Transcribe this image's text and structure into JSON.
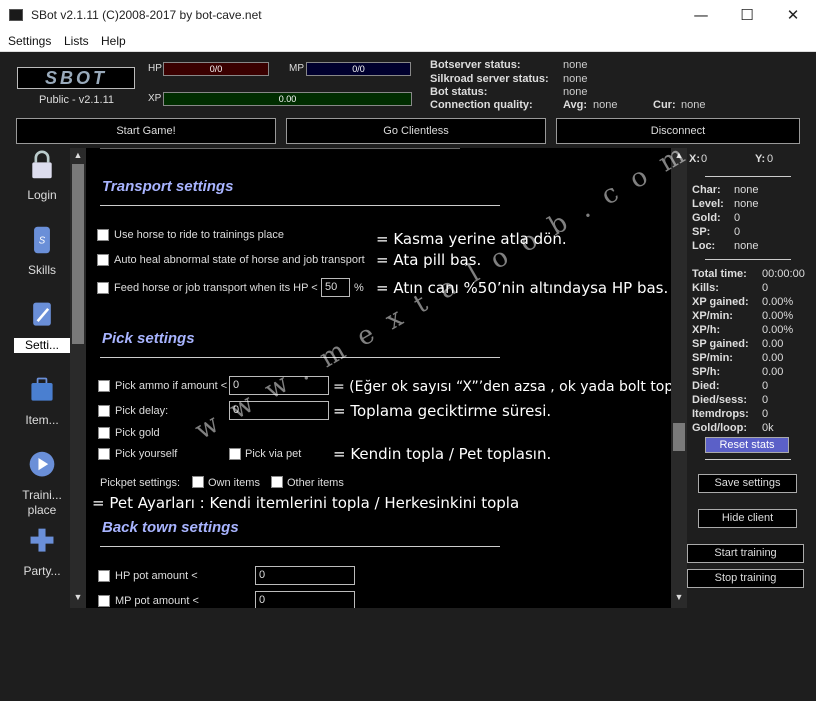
{
  "window": {
    "title": "SBot v2.1.11 (C)2008-2017 by bot-cave.net",
    "minimize": "—",
    "maximize": "☐",
    "close": "✕"
  },
  "menu": [
    "Settings",
    "Lists",
    "Help"
  ],
  "header": {
    "logo": "SBOT",
    "version": "Public - v2.1.11",
    "hp_label": "HP",
    "hp_value": "0/0",
    "mp_label": "MP",
    "mp_value": "0/0",
    "xp_label": "XP",
    "xp_value": "0.00",
    "status": [
      {
        "label": "Botserver status:",
        "value": "none"
      },
      {
        "label": "Silkroad server status:",
        "value": "none"
      },
      {
        "label": "Bot status:",
        "value": "none"
      },
      {
        "label": "Connection quality:",
        "value": "",
        "avg_label": "Avg:",
        "avg_value": "none",
        "cur_label": "Cur:",
        "cur_value": "none"
      }
    ]
  },
  "buttons": {
    "start_game": "Start Game!",
    "go_clientless": "Go Clientless",
    "disconnect": "Disconnect"
  },
  "sidebar": [
    {
      "label": "Login",
      "icon": "lock-icon"
    },
    {
      "label": "Skills",
      "icon": "scroll-icon"
    },
    {
      "label": "Setti...",
      "icon": "settings-icon"
    },
    {
      "label": "Item...",
      "icon": "briefcase-icon"
    },
    {
      "label": "Traini... place",
      "icon": "play-icon"
    },
    {
      "label": "Party...",
      "icon": "plus-icon"
    }
  ],
  "panel": {
    "transport": {
      "title": "Transport settings",
      "opt1": "Use horse to ride to trainings place",
      "opt2": "Auto heal abnormal state of horse and job transport",
      "opt3": "Feed horse or job transport when its HP <",
      "opt3_value": "50",
      "opt3_unit": "%",
      "note1": "= Kasma yerine atla dön.",
      "note2": "= Ata pill bas.",
      "note3": "= Atın canı %50’nin altındaysa HP bas."
    },
    "pick": {
      "title": "Pick settings",
      "ammo": "Pick ammo if amount <",
      "ammo_value": "0",
      "delay": "Pick delay:",
      "delay_value": "0",
      "gold": "Pick gold",
      "yourself": "Pick yourself",
      "via_pet": "Pick via pet",
      "pickpet": "Pickpet settings:",
      "own_items": "Own items",
      "other_items": "Other items",
      "note_ammo": "= (Eğer ok sayısı “X”’den azsa , ok yada bolt topla)",
      "note_delay": "= Toplama geciktirme süresi.",
      "note_pet": "= Kendin topla / Pet toplasın.",
      "note_pickpet": "= Pet Ayarları : Kendi itemlerini topla / Herkesinkini topla"
    },
    "backtown": {
      "title": "Back town settings",
      "hp": "HP pot amount <",
      "hp_value": "0",
      "mp": "MP pot amount <",
      "mp_value": "0"
    }
  },
  "watermark": "www.mextaloob.com",
  "right": {
    "x_label": "X:",
    "x_value": "0",
    "y_label": "Y:",
    "y_value": "0",
    "char": [
      {
        "k": "Char:",
        "v": "none"
      },
      {
        "k": "Level:",
        "v": "none"
      },
      {
        "k": "Gold:",
        "v": "0"
      },
      {
        "k": "SP:",
        "v": "0"
      },
      {
        "k": "Loc:",
        "v": "none"
      }
    ],
    "stats": [
      {
        "k": "Total time:",
        "v": "00:00:00"
      },
      {
        "k": "Kills:",
        "v": "0"
      },
      {
        "k": "XP gained:",
        "v": "0.00%"
      },
      {
        "k": "XP/min:",
        "v": "0.00%"
      },
      {
        "k": "XP/h:",
        "v": "0.00%"
      },
      {
        "k": "SP gained:",
        "v": "0.00"
      },
      {
        "k": "SP/min:",
        "v": "0.00"
      },
      {
        "k": "SP/h:",
        "v": "0.00"
      },
      {
        "k": "Died:",
        "v": "0"
      },
      {
        "k": "Died/sess:",
        "v": "0"
      },
      {
        "k": "Itemdrops:",
        "v": "0"
      },
      {
        "k": "Gold/loop:",
        "v": "0k"
      }
    ],
    "reset_stats": "Reset stats",
    "save_settings": "Save settings",
    "hide_client": "Hide client",
    "start_training": "Start training",
    "stop_training": "Stop training"
  }
}
